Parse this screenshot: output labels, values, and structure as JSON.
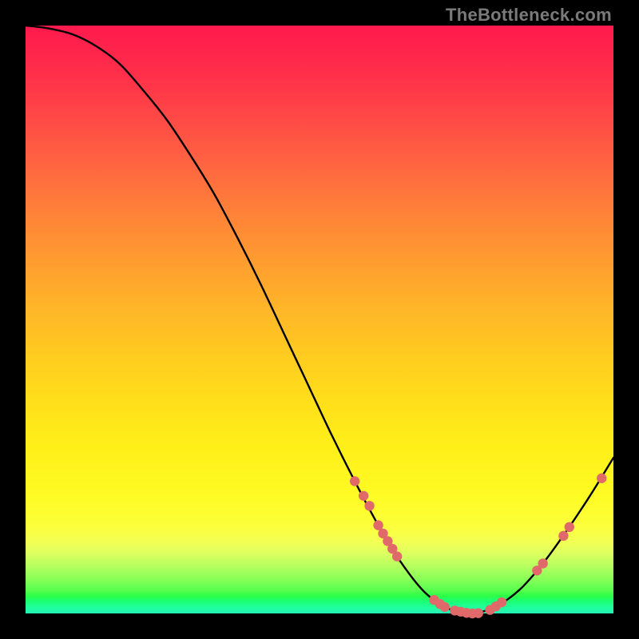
{
  "watermark": "TheBottleneck.com",
  "domain": "Chart",
  "chart_data": {
    "type": "line",
    "title": "",
    "xlabel": "",
    "ylabel": "",
    "note": "Bottleneck curve — valley at lowest bottleneck. Values estimated from plot (no axis labels). x and y normalized 0–100 (x: component index left→right, y: bottleneck % where 100 = top/red, 0 = bottom/green).",
    "xlim": [
      0,
      100
    ],
    "ylim": [
      0,
      100
    ],
    "series": [
      {
        "name": "bottleneck-curve",
        "x": [
          0,
          4,
          8,
          12,
          16,
          20,
          24,
          28,
          32,
          36,
          40,
          44,
          48,
          52,
          56,
          60,
          64,
          68,
          72,
          76,
          80,
          84,
          88,
          92,
          96,
          100
        ],
        "y": [
          100,
          99.5,
          98.5,
          96.5,
          93.5,
          89,
          84,
          78,
          71.5,
          64,
          56,
          47.5,
          39,
          30.5,
          22.5,
          15,
          8.5,
          3.5,
          0.8,
          0,
          1.2,
          4,
          8.5,
          14,
          20,
          26.5
        ]
      }
    ],
    "markers": {
      "name": "highlighted-components",
      "color": "#e06a6a",
      "points": [
        {
          "x": 56,
          "y": 22.5
        },
        {
          "x": 57.5,
          "y": 20
        },
        {
          "x": 58.5,
          "y": 18.3
        },
        {
          "x": 60,
          "y": 15
        },
        {
          "x": 60.8,
          "y": 13.6
        },
        {
          "x": 61.6,
          "y": 12.3
        },
        {
          "x": 62.4,
          "y": 11
        },
        {
          "x": 63.2,
          "y": 9.7
        },
        {
          "x": 69.5,
          "y": 2.3
        },
        {
          "x": 70.5,
          "y": 1.6
        },
        {
          "x": 71.3,
          "y": 1.1
        },
        {
          "x": 73,
          "y": 0.5
        },
        {
          "x": 74,
          "y": 0.3
        },
        {
          "x": 75,
          "y": 0.1
        },
        {
          "x": 76,
          "y": 0
        },
        {
          "x": 77,
          "y": 0.05
        },
        {
          "x": 79,
          "y": 0.6
        },
        {
          "x": 80,
          "y": 1.2
        },
        {
          "x": 81,
          "y": 1.9
        },
        {
          "x": 87,
          "y": 7.3
        },
        {
          "x": 88,
          "y": 8.5
        },
        {
          "x": 91.5,
          "y": 13.2
        },
        {
          "x": 92.5,
          "y": 14.7
        },
        {
          "x": 98,
          "y": 23
        }
      ]
    }
  }
}
